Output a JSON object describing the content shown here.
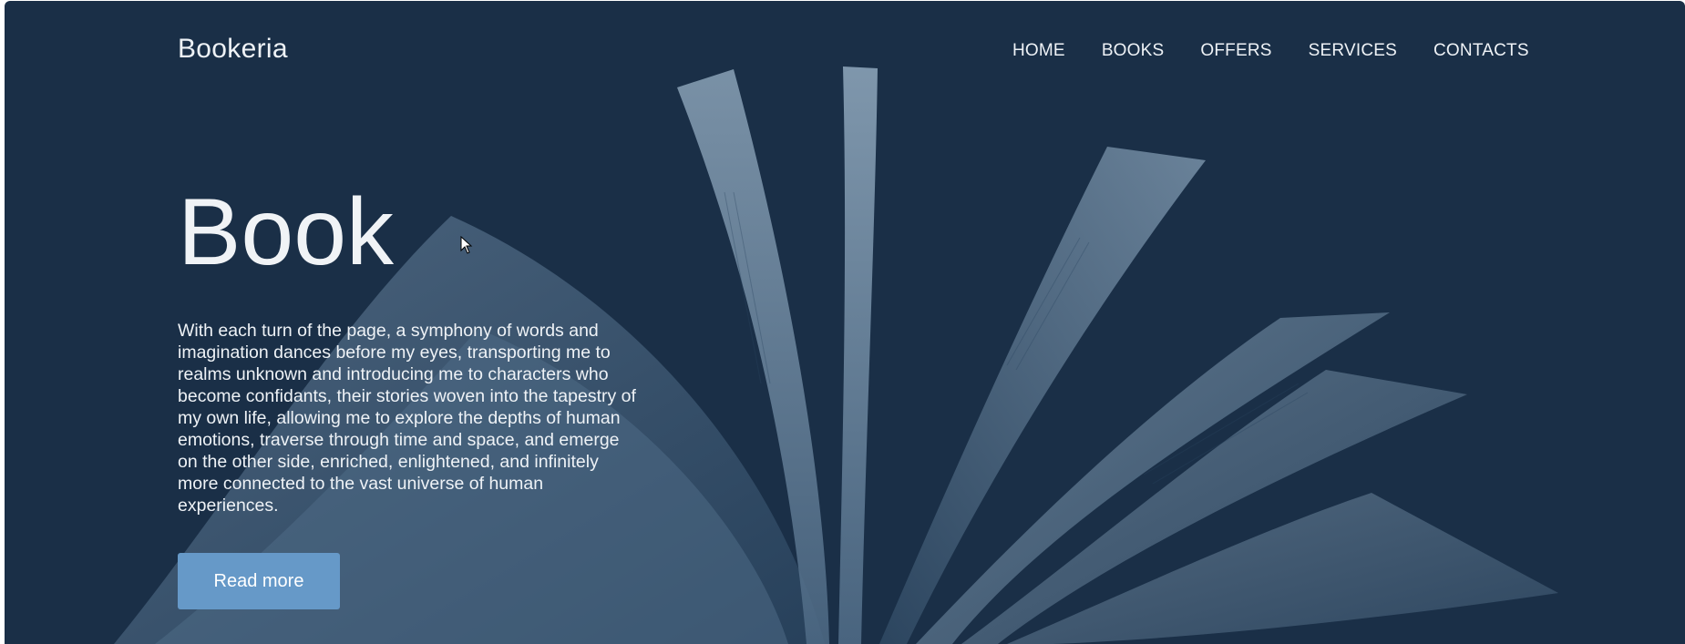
{
  "site": {
    "logo": "Bookeria"
  },
  "nav": {
    "items": [
      {
        "label": "HOME"
      },
      {
        "label": "BOOKS"
      },
      {
        "label": "OFFERS"
      },
      {
        "label": "SERVICES"
      },
      {
        "label": "CONTACTS"
      }
    ]
  },
  "hero": {
    "title": "Book",
    "description": "With each turn of the page, a symphony of words and imagination dances before my eyes, transporting me to realms unknown and introducing me to characters who become confidants, their stories woven into the tapestry of my own life, allowing me to explore the depths of human emotions, traverse through time and space, and emerge on the other side, enriched, enlightened, and infinitely more connected to the vast universe of human experiences.",
    "button_label": "Read more"
  },
  "colors": {
    "background": "#1a2f47",
    "accent": "#6699c8",
    "text": "#eef2f6"
  },
  "icons": {
    "cursor": "mouse-pointer-icon",
    "background_image": "open-book-image"
  }
}
